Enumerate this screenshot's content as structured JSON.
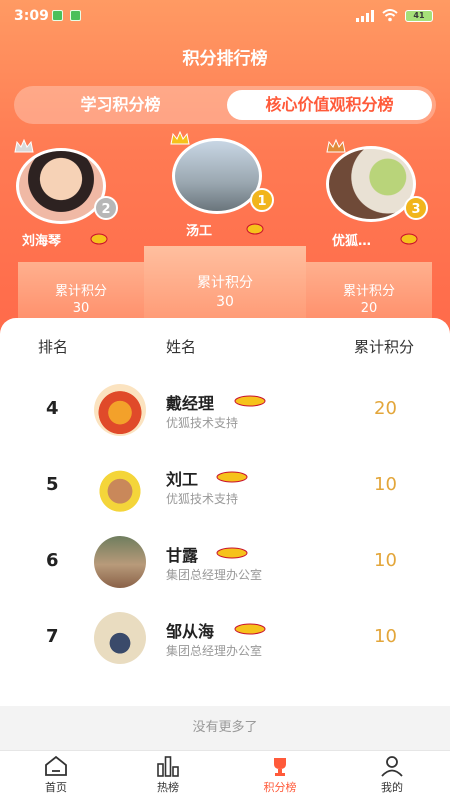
{
  "status": {
    "time": "3:09",
    "battery": "41"
  },
  "title": "积分排行榜",
  "tabs": [
    {
      "label": "学习积分榜"
    },
    {
      "label": "核心价值观积分榜"
    }
  ],
  "podium": {
    "label": "累计积分",
    "top": [
      {
        "name": "刘海琴",
        "rank": "2",
        "score": "30"
      },
      {
        "name": "汤工",
        "rank": "1",
        "score": "30"
      },
      {
        "name": "优狐…",
        "rank": "3",
        "score": "20"
      }
    ]
  },
  "table": {
    "headers": [
      "排名",
      "姓名",
      "累计积分"
    ],
    "rows": [
      {
        "rank": "4",
        "name": "戴经理",
        "dept": "优狐技术支持",
        "score": "20"
      },
      {
        "rank": "5",
        "name": "刘工",
        "dept": "优狐技术支持",
        "score": "10"
      },
      {
        "rank": "6",
        "name": "甘露",
        "dept": "集团总经理办公室",
        "score": "10"
      },
      {
        "rank": "7",
        "name": "邹从海",
        "dept": "集团总经理办公室",
        "score": "10"
      }
    ]
  },
  "no_more": "没有更多了",
  "nav": [
    {
      "label": "首页"
    },
    {
      "label": "热榜"
    },
    {
      "label": "积分榜"
    },
    {
      "label": "我的"
    }
  ],
  "colors": {
    "accent": "#ff5a3a",
    "score": "#e3a63a"
  }
}
